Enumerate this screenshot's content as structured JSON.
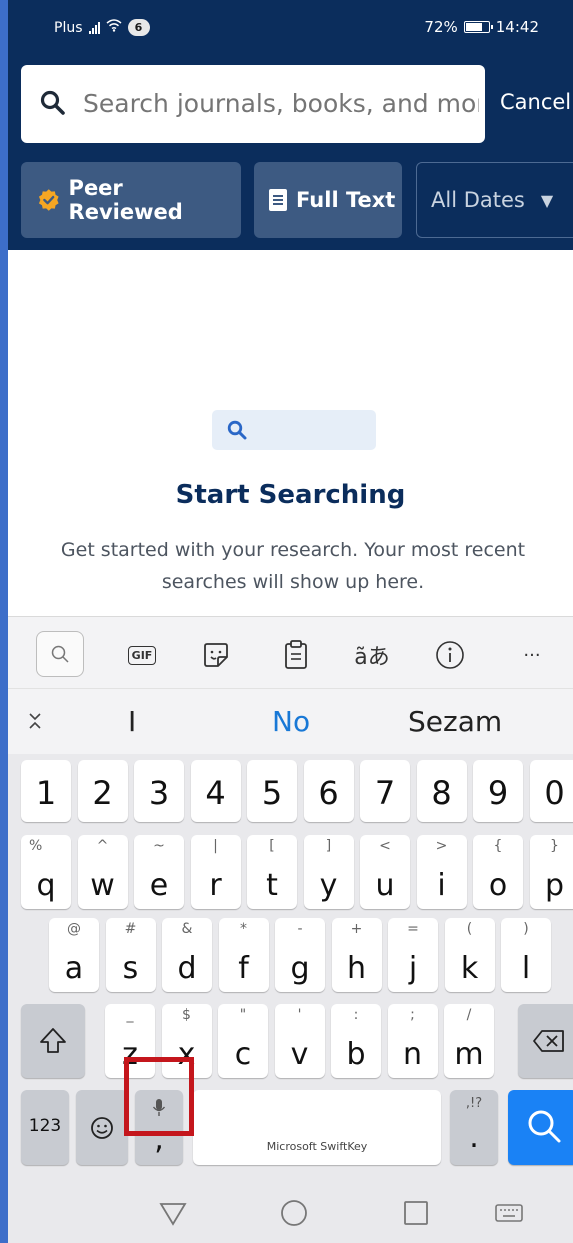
{
  "status": {
    "carrier": "Plus",
    "sim_badge": "6",
    "battery_percent": "72%",
    "time": "14:42"
  },
  "search": {
    "placeholder": "Search journals, books, and more",
    "cancel_label": "Cancel"
  },
  "filters": {
    "peer_reviewed_label": "Peer Reviewed",
    "full_text_label": "Full Text",
    "dates_label": "All Dates"
  },
  "empty_state": {
    "title": "Start Searching",
    "subtitle": "Get started with your research. Your most recent searches will show up here."
  },
  "keyboard": {
    "toolbar": {
      "gif_label": "GIF",
      "more_label": "···"
    },
    "suggestions": [
      "I",
      "No",
      "Sezam"
    ],
    "number_row": [
      "1",
      "2",
      "3",
      "4",
      "5",
      "6",
      "7",
      "8",
      "9",
      "0"
    ],
    "row1": [
      {
        "main": "q",
        "alt": "%"
      },
      {
        "main": "w",
        "alt": "^"
      },
      {
        "main": "e",
        "alt": "~"
      },
      {
        "main": "r",
        "alt": "|"
      },
      {
        "main": "t",
        "alt": "["
      },
      {
        "main": "y",
        "alt": "]"
      },
      {
        "main": "u",
        "alt": "<"
      },
      {
        "main": "i",
        "alt": ">"
      },
      {
        "main": "o",
        "alt": "{"
      },
      {
        "main": "p",
        "alt": "}"
      }
    ],
    "row2": [
      {
        "main": "a",
        "alt": "@"
      },
      {
        "main": "s",
        "alt": "#"
      },
      {
        "main": "d",
        "alt": "&"
      },
      {
        "main": "f",
        "alt": "*"
      },
      {
        "main": "g",
        "alt": "-"
      },
      {
        "main": "h",
        "alt": "+"
      },
      {
        "main": "j",
        "alt": "="
      },
      {
        "main": "k",
        "alt": "("
      },
      {
        "main": "l",
        "alt": ")"
      }
    ],
    "row3": [
      {
        "main": "z",
        "alt": "_"
      },
      {
        "main": "x",
        "alt": "$"
      },
      {
        "main": "c",
        "alt": "\""
      },
      {
        "main": "v",
        "alt": "'"
      },
      {
        "main": "b",
        "alt": ":"
      },
      {
        "main": "n",
        "alt": ";"
      },
      {
        "main": "m",
        "alt": "/"
      }
    ],
    "numbers_key_label": "123",
    "comma_label": ",",
    "space_label": "Microsoft SwiftKey",
    "period_label": ".",
    "period_alt": ",!?"
  },
  "colors": {
    "header_bg": "#0b2d5c",
    "chip_bg": "#3d5a82",
    "accent_blue": "#1a82f5",
    "highlight_red": "#c4161c",
    "title_navy": "#0b2d5c",
    "verified_badge": "#f5a623"
  },
  "icons": {
    "search": "search-icon",
    "peer_reviewed": "verified-badge-icon",
    "full_text": "document-icon",
    "dropdown": "caret-down-icon",
    "mic": "mic-icon",
    "shift": "shift-icon",
    "backspace": "backspace-icon",
    "emoji": "emoji-icon"
  }
}
